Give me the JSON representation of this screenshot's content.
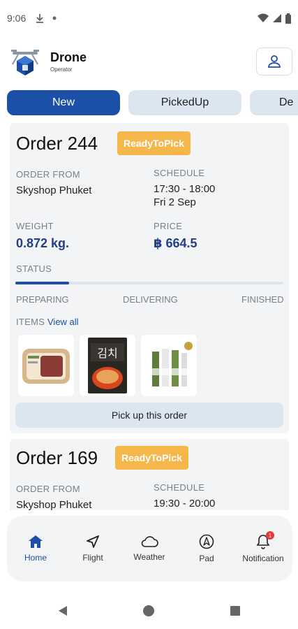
{
  "status_bar": {
    "time": "9:06"
  },
  "header": {
    "app_name": "Drone",
    "app_subtitle": "Operator"
  },
  "tabs": [
    {
      "label": "New"
    },
    {
      "label": "PickedUp"
    },
    {
      "label": "De"
    }
  ],
  "orders": [
    {
      "title": "Order 244",
      "badge": "ReadyToPick",
      "order_from_label": "ORDER FROM",
      "order_from": "Skyshop Phuket",
      "schedule_label": "SCHEDULE",
      "schedule_time": "17:30 - 18:00",
      "schedule_date": "Fri 2 Sep",
      "weight_label": "WEIGHT",
      "weight": "0.872 kg.",
      "price_label": "PRICE",
      "price": "฿ 664.5",
      "status_label": "STATUS",
      "progress": 0.2,
      "steps": [
        "PREPARING",
        "DELIVERING",
        "FINISHED"
      ],
      "items_label": "ITEMS",
      "view_all": "View all",
      "pickup_button": "Pick up this order"
    },
    {
      "title": "Order 169",
      "badge": "ReadyToPick",
      "order_from_label": "ORDER FROM",
      "order_from": "Skyshop Phuket",
      "schedule_label": "SCHEDULE",
      "schedule_time": "19:30 - 20:00"
    }
  ],
  "bottom_nav": [
    {
      "label": "Home",
      "icon": "home-icon"
    },
    {
      "label": "Flight",
      "icon": "navigation-arrow-icon"
    },
    {
      "label": "Weather",
      "icon": "cloud-icon"
    },
    {
      "label": "Pad",
      "icon": "compass-icon"
    },
    {
      "label": "Notification",
      "icon": "bell-icon"
    }
  ],
  "notification_count": "1",
  "colors": {
    "primary": "#1b4fa8",
    "badge": "#f6b74a",
    "tab_inactive": "#dce6f1",
    "card_bg": "#f3f4f6"
  }
}
